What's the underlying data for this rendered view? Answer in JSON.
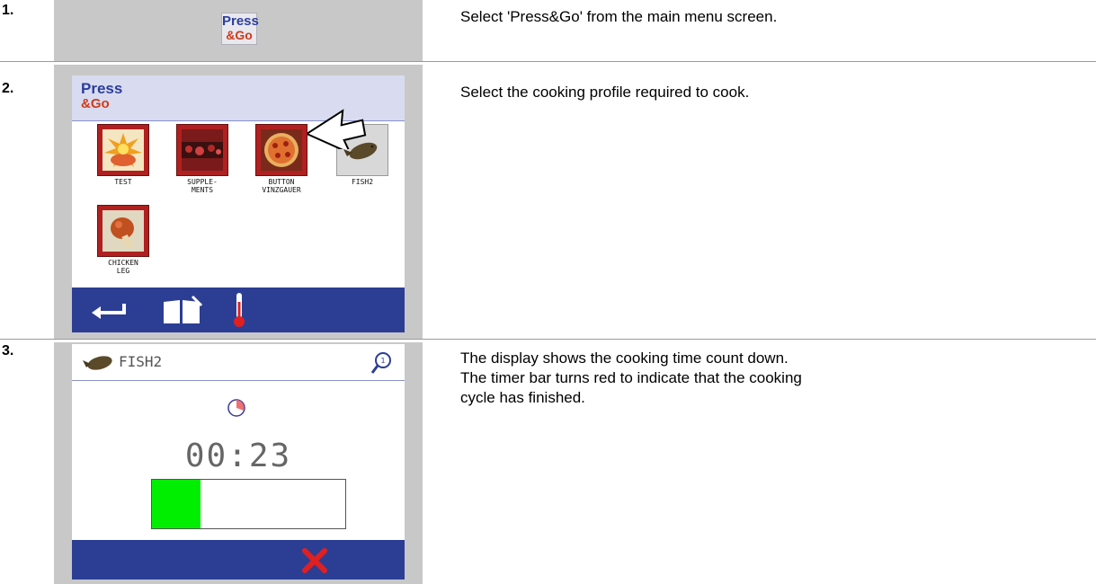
{
  "steps": [
    {
      "number": "1.",
      "description": "Select 'Press&Go' from the main menu screen."
    },
    {
      "number": "2.",
      "description": "Select the cooking profile required to cook."
    },
    {
      "number": "3.",
      "description_lines": [
        "The display shows the cooking time count down.",
        "The timer bar turns red to indicate that the cooking cycle has finished."
      ]
    }
  ],
  "logo": {
    "line1": "Press",
    "line2": "&Go"
  },
  "menu_screen": {
    "header_line1": "Press",
    "header_line2": "&Go",
    "profiles": [
      {
        "label_line1": "TEST",
        "label_line2": "",
        "icon": "explosion-food-icon",
        "selected": false
      },
      {
        "label_line1": "SUPPLE-",
        "label_line2": "MENTS",
        "icon": "supplements-icon",
        "selected": false
      },
      {
        "label_line1": "BUTTON",
        "label_line2": "VINZGAUER",
        "icon": "pizza-icon",
        "selected": false
      },
      {
        "label_line1": "FISH2",
        "label_line2": "",
        "icon": "fish-icon",
        "selected": true
      },
      {
        "label_line1": "CHICKEN",
        "label_line2": "LEG",
        "icon": "chicken-leg-icon",
        "selected": false
      }
    ],
    "bottom_icons": [
      "back-arrow-icon",
      "recipe-book-icon",
      "thermometer-icon"
    ]
  },
  "timer_screen": {
    "title": "FISH2",
    "time": "00:23",
    "progress_fraction": 0.25,
    "progress_color": "#00ee00",
    "cancel_icon": "cancel-x-icon",
    "search_icon": "magnifier-icon"
  },
  "colors": {
    "bar_blue": "#2c3e94",
    "header_light": "#d9dcf0",
    "tile_red": "#b02020",
    "cancel_red": "#e02020"
  }
}
